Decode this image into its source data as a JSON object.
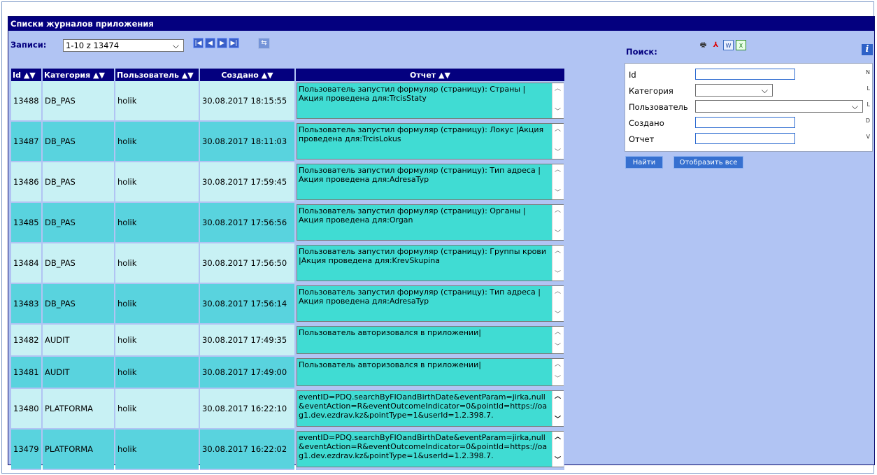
{
  "title": "Списки журналов приложения",
  "records": {
    "label": "Записи:",
    "selected": "1-10 z 13474"
  },
  "nav": {
    "first": "K",
    "prev": "◄",
    "next": "►",
    "last": "►|"
  },
  "columns": [
    {
      "label": "Id",
      "sort": "▲▼"
    },
    {
      "label": "Категория",
      "sort": "▲▼"
    },
    {
      "label": "Пользователь",
      "sort": "▲▼"
    },
    {
      "label": "Создано",
      "sort": "▲▼"
    },
    {
      "label": "Отчет",
      "sort": "▲▼"
    }
  ],
  "rows": [
    {
      "id": "13488",
      "category": "DB_PAS",
      "user": "holik",
      "created": "30.08.2017 18:15:55",
      "report": "Пользователь запустил формуляр (страницу): Страны |Акция проведена для:TrcisStaty"
    },
    {
      "id": "13487",
      "category": "DB_PAS",
      "user": "holik",
      "created": "30.08.2017 18:11:03",
      "report": "Пользователь запустил формуляр (страницу): Локус |Акция проведена для:TrcisLokus"
    },
    {
      "id": "13486",
      "category": "DB_PAS",
      "user": "holik",
      "created": "30.08.2017 17:59:45",
      "report": "Пользователь запустил формуляр (страницу): Тип адреса |Акция проведена для:AdresaTyp"
    },
    {
      "id": "13485",
      "category": "DB_PAS",
      "user": "holik",
      "created": "30.08.2017 17:56:56",
      "report": "Пользователь запустил формуляр (страницу): Органы |Акция проведена для:Organ"
    },
    {
      "id": "13484",
      "category": "DB_PAS",
      "user": "holik",
      "created": "30.08.2017 17:56:50",
      "report": "Пользователь запустил формуляр (страницу): Группы крови |Акция проведена для:KrevSkupina"
    },
    {
      "id": "13483",
      "category": "DB_PAS",
      "user": "holik",
      "created": "30.08.2017 17:56:14",
      "report": "Пользователь запустил формуляр (страницу): Тип адреса |Акция проведена для:AdresaTyp"
    },
    {
      "id": "13482",
      "category": "AUDIT",
      "user": "holik",
      "created": "30.08.2017 17:49:35",
      "report": "Пользователь авторизовался в приложении|"
    },
    {
      "id": "13481",
      "category": "AUDIT",
      "user": "holik",
      "created": "30.08.2017 17:49:00",
      "report": "Пользователь авторизовался в приложении|"
    },
    {
      "id": "13480",
      "category": "PLATFORMA",
      "user": "holik",
      "created": "30.08.2017 16:22:10",
      "report": "eventID=PDQ.searchByFIOandBirthDate&eventParam=jirka,null&eventAction=R&eventOutcomeIndicator=0&pointId=https://oag1.dev.ezdrav.kz&pointType=1&userId=1.2.398.7."
    },
    {
      "id": "13479",
      "category": "PLATFORMA",
      "user": "holik",
      "created": "30.08.2017 16:22:02",
      "report": "eventID=PDQ.searchByFIOandBirthDate&eventParam=jirka,null&eventAction=R&eventOutcomeIndicator=0&pointId=https://oag1.dev.ezdrav.kz&pointType=1&userId=1.2.398.7."
    }
  ],
  "search": {
    "title": "Поиск:",
    "fields": [
      {
        "label": "Id",
        "op": "N"
      },
      {
        "label": "Категория",
        "op": "L"
      },
      {
        "label": "Пользователь",
        "op": "L"
      },
      {
        "label": "Создано",
        "op": "D"
      },
      {
        "label": "Отчет",
        "op": "V"
      }
    ],
    "find_button": "Найти",
    "show_all_button": "Отобразить все"
  },
  "icons": {
    "print": "printer-icon",
    "pdf": "pdf-icon",
    "word": "word-icon",
    "excel": "excel-icon",
    "info": "info-icon",
    "refresh": "refresh-icon"
  }
}
